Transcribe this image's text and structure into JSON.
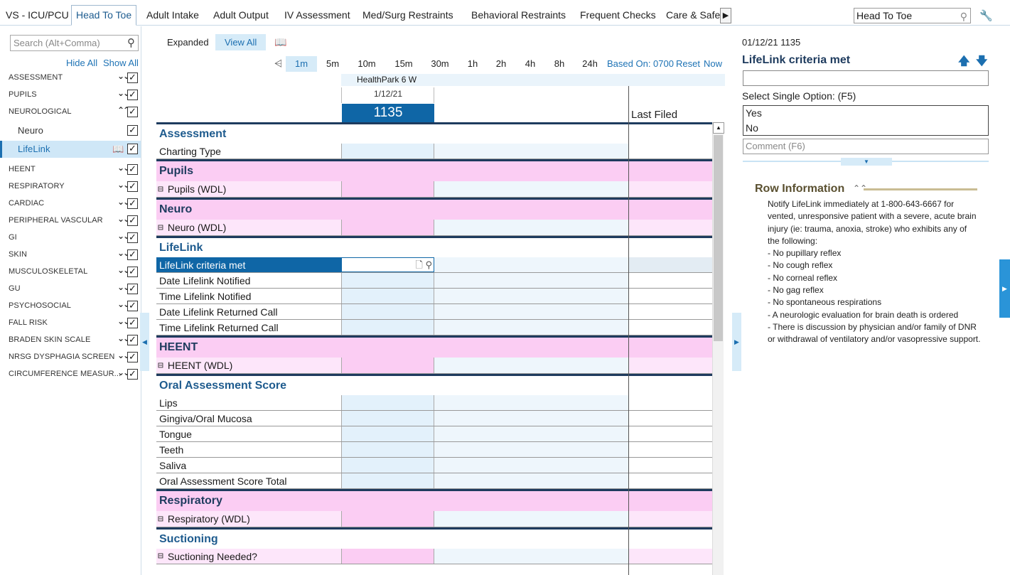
{
  "tabs": [
    {
      "label": "VS - ICU/PCU",
      "active": false
    },
    {
      "label": "Head To Toe",
      "active": true
    },
    {
      "label": "Adult Intake",
      "active": false
    },
    {
      "label": "Adult Output",
      "active": false
    },
    {
      "label": "IV Assessment",
      "active": false
    },
    {
      "label": "Med/Surg Restraints",
      "active": false
    },
    {
      "label": "Behavioral Restraints",
      "active": false
    },
    {
      "label": "Frequent Checks",
      "active": false
    },
    {
      "label": "Care & Safe",
      "active": false
    }
  ],
  "top_search": {
    "value": "Head To Toe"
  },
  "nav": {
    "search_placeholder": "Search (Alt+Comma)",
    "hide_all": "Hide All",
    "show_all": "Show All",
    "items": [
      {
        "label": "ASSESSMENT",
        "checked": true
      },
      {
        "label": "PUPILS",
        "checked": true
      },
      {
        "label": "NEUROLOGICAL",
        "checked": true
      },
      {
        "label": "Neuro",
        "checked": true
      },
      {
        "label": "LifeLink",
        "checked": true
      },
      {
        "label": "HEENT",
        "checked": true
      },
      {
        "label": "RESPIRATORY",
        "checked": true
      },
      {
        "label": "CARDIAC",
        "checked": true
      },
      {
        "label": "PERIPHERAL VASCULAR",
        "checked": true
      },
      {
        "label": "GI",
        "checked": true
      },
      {
        "label": "SKIN",
        "checked": true
      },
      {
        "label": "MUSCULOSKELETAL",
        "checked": true
      },
      {
        "label": "GU",
        "checked": true
      },
      {
        "label": "PSYCHOSOCIAL",
        "checked": true
      },
      {
        "label": "FALL RISK",
        "checked": true
      },
      {
        "label": "BRADEN SKIN SCALE",
        "checked": true
      },
      {
        "label": "NRSG DYSPHAGIA SCREEN",
        "checked": true
      },
      {
        "label": "CIRCUMFERENCE MEASUR...",
        "checked": true
      }
    ]
  },
  "toolbar": {
    "expanded": "Expanded",
    "view_all": "View All"
  },
  "intervals": [
    "1m",
    "5m",
    "10m",
    "15m",
    "30m",
    "1h",
    "2h",
    "4h",
    "8h",
    "24h"
  ],
  "interval_links": {
    "based_on": "Based On: 0700",
    "reset": "Reset",
    "now": "Now"
  },
  "column": {
    "unit": "HealthPark 6 W",
    "date": "1/12/21",
    "time": "1135",
    "last_filed": "Last Filed"
  },
  "rows": [
    {
      "label": "Assessment",
      "kind": "sec"
    },
    {
      "label": "Charting Type",
      "kind": "plain"
    },
    {
      "label": "Pupils",
      "kind": "secpink"
    },
    {
      "label": "Pupils (WDL)",
      "kind": "wdl"
    },
    {
      "label": "Neuro",
      "kind": "secpink"
    },
    {
      "label": "Neuro (WDL)",
      "kind": "wdl"
    },
    {
      "label": "LifeLink",
      "kind": "sec"
    },
    {
      "label": "LifeLink criteria met",
      "kind": "selected"
    },
    {
      "label": "Date Lifelink Notified",
      "kind": "plain"
    },
    {
      "label": "Time Lifelink Notified",
      "kind": "plain"
    },
    {
      "label": "Date Lifelink Returned Call",
      "kind": "plain"
    },
    {
      "label": "Time Lifelink Returned Call",
      "kind": "plain"
    },
    {
      "label": "HEENT",
      "kind": "secpink"
    },
    {
      "label": "HEENT (WDL)",
      "kind": "wdl"
    },
    {
      "label": "Oral Assessment Score",
      "kind": "sec"
    },
    {
      "label": "Lips",
      "kind": "plain"
    },
    {
      "label": "Gingiva/Oral Mucosa",
      "kind": "plain"
    },
    {
      "label": "Tongue",
      "kind": "plain"
    },
    {
      "label": "Teeth",
      "kind": "plain"
    },
    {
      "label": "Saliva",
      "kind": "plain"
    },
    {
      "label": "Oral Assessment Score Total",
      "kind": "plain"
    },
    {
      "label": "Respiratory",
      "kind": "secpink"
    },
    {
      "label": "Respiratory (WDL)",
      "kind": "wdl"
    },
    {
      "label": "Suctioning",
      "kind": "sec"
    },
    {
      "label": "Suctioning Needed?",
      "kind": "wdl-plain"
    }
  ],
  "right_panel": {
    "timestamp": "01/12/21 1135",
    "title": "LifeLink criteria met",
    "select_label": "Select Single Option: (F5)",
    "options": [
      "Yes",
      "No"
    ],
    "comment_placeholder": "Comment (F6)",
    "row_info_title": "Row Information",
    "row_info_text": "Notify LifeLink immediately at 1-800-643-6667 for vented, unresponsive patient with a severe, acute brain injury (ie: trauma, anoxia, stroke) who exhibits any of the following:\n- No pupillary reflex\n- No cough reflex\n- No corneal reflex\n- No gag reflex\n- No spontaneous respirations\n- A neurologic evaluation for brain death is ordered\n- There is discussion by physician and/or family of DNR or withdrawal of ventilatory and/or vasopressive support."
  }
}
